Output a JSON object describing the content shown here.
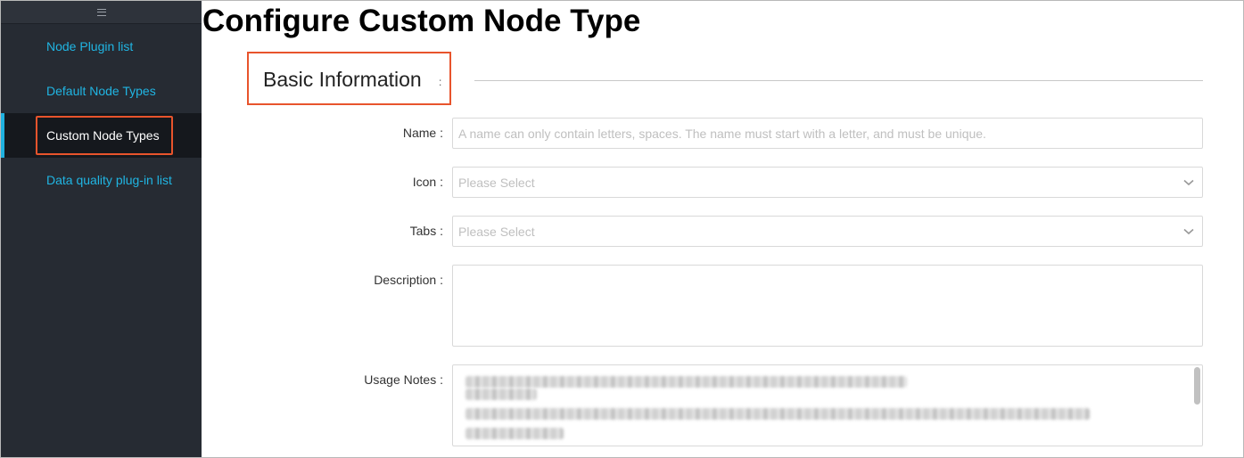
{
  "sidebar": {
    "menu_icon": "hamburger-icon",
    "items": [
      {
        "label": "Node Plugin list"
      },
      {
        "label": "Default Node Types"
      },
      {
        "label": "Custom Node Types"
      },
      {
        "label": "Data quality plug-in list"
      }
    ],
    "active_item": "Custom Node Types"
  },
  "page": {
    "title": "Configure Custom Node Type"
  },
  "section": {
    "title": "Basic Information",
    "colon": ":"
  },
  "form": {
    "name": {
      "label": "Name :",
      "placeholder": "A name can only contain letters, spaces. The name must start with a letter, and must be unique.",
      "value": ""
    },
    "icon": {
      "label": "Icon :",
      "placeholder": "Please Select",
      "chevron": "chevron-down-icon"
    },
    "tabs": {
      "label": "Tabs :",
      "placeholder": "Please Select",
      "chevron": "chevron-down-icon"
    },
    "description": {
      "label": "Description :",
      "value": ""
    },
    "usage_notes": {
      "label": "Usage Notes :"
    }
  },
  "colors": {
    "sidebar_bg": "#262b33",
    "active_bg": "#15181d",
    "link": "#20b5e3",
    "highlight": "#e8542c"
  }
}
